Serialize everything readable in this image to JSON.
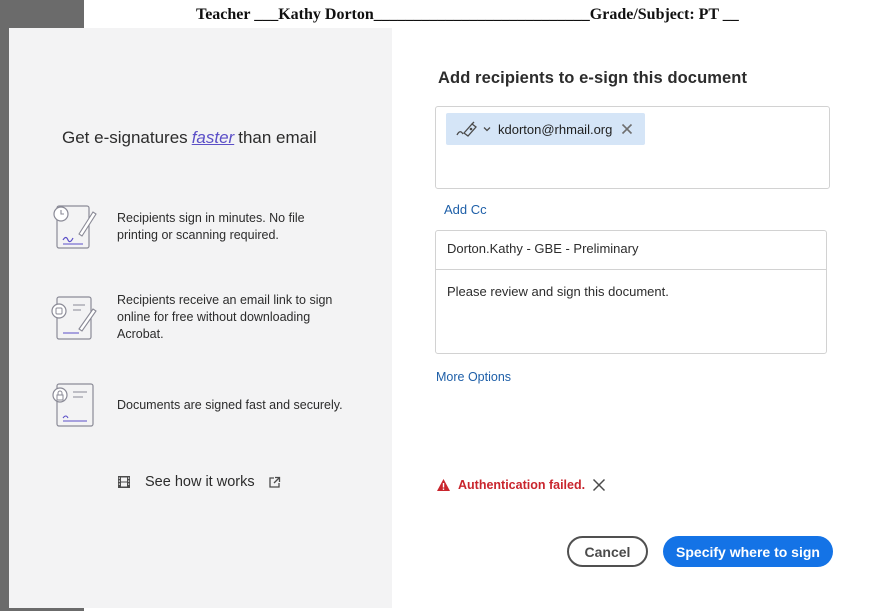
{
  "background_doc": {
    "line": "Teacher ___Kathy Dorton___________________________Grade/Subject: PT __"
  },
  "left": {
    "title_pre": "Get e-signatures",
    "title_em": "faster",
    "title_post": "than email",
    "features": [
      {
        "icon": "clock-pen-document-icon",
        "text": "Recipients sign in minutes. No file printing or scanning required."
      },
      {
        "icon": "email-document-icon",
        "text": "Recipients receive an email link to sign online for free without downloading Acrobat."
      },
      {
        "icon": "lock-document-icon",
        "text": "Documents are signed fast and securely."
      }
    ],
    "see_how": "See how it works",
    "see_how_icons": [
      "film-icon",
      "external-link-icon"
    ]
  },
  "right": {
    "title": "Add recipients to e-sign this document",
    "recipient": {
      "email": "kdorton@rhmail.org",
      "role_icon": "signer-pen-icon"
    },
    "add_cc": "Add Cc",
    "subject": "Dorton.Kathy - GBE - Preliminary",
    "message": "Please review and sign this document.",
    "more_options": "More Options",
    "error": "Authentication failed.",
    "cancel": "Cancel",
    "primary": "Specify where to sign"
  },
  "colors": {
    "accent": "#1473e6",
    "link": "#1e5fa8",
    "error": "#c9252d",
    "chip": "#d5e5f7",
    "promo_em": "#5b4fc7"
  }
}
